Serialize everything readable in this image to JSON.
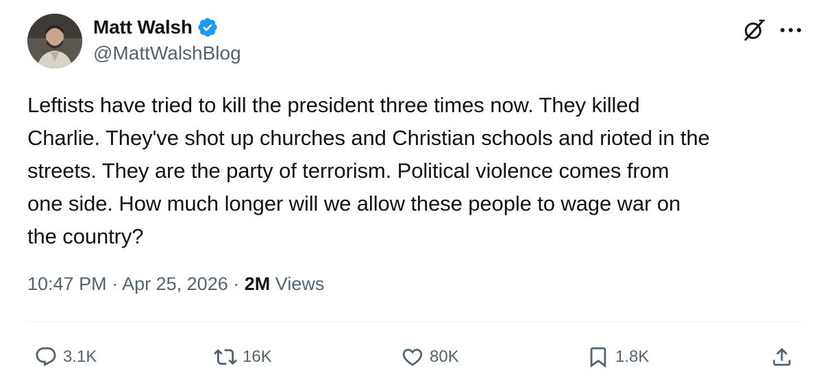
{
  "author": {
    "display_name": "Matt Walsh",
    "handle": "@MattWalshBlog",
    "verified": true,
    "badge_color": "#1d9bf0"
  },
  "tweet": {
    "text": "Leftists have tried to kill the president three times now. They killed\nCharlie. They've shot up churches and Christian schools and rioted in the\nstreets. They are the party of terrorism. Political violence comes from\none side. How much longer will we allow these people to wage war on\nthe country?",
    "time": "10:47 PM",
    "separator": "·",
    "date": "Apr 25, 2026",
    "views_count": "2M",
    "views_label": "Views"
  },
  "actions": {
    "replies": "3.1K",
    "reposts": "16K",
    "likes": "80K",
    "bookmarks": "1.8K"
  },
  "icons": {
    "header": [
      "grok-icon",
      "more-icon"
    ],
    "actions": [
      "reply-icon",
      "repost-icon",
      "like-icon",
      "bookmark-icon",
      "share-icon"
    ]
  },
  "colors": {
    "text_primary": "#0f1419",
    "text_secondary": "#536471",
    "divider": "#eff3f4"
  }
}
